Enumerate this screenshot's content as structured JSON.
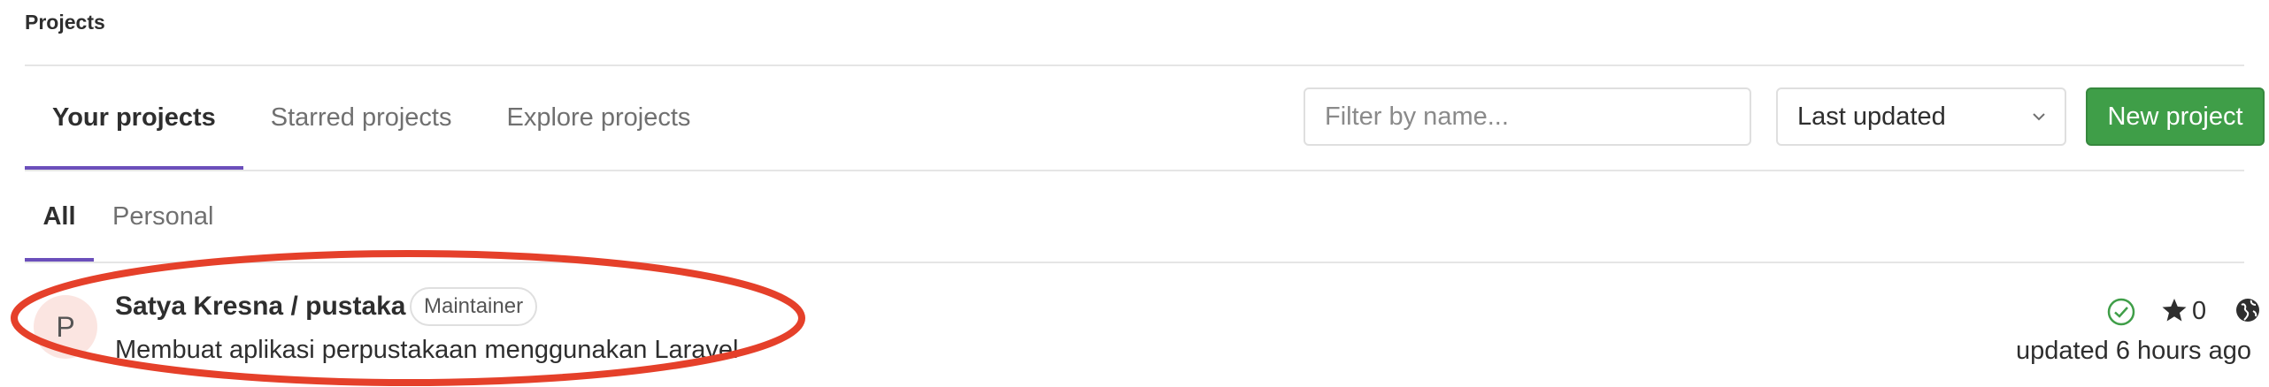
{
  "breadcrumb": "Projects",
  "tabs": [
    {
      "label": "Your projects",
      "active": true
    },
    {
      "label": "Starred projects",
      "active": false
    },
    {
      "label": "Explore projects",
      "active": false
    }
  ],
  "filter": {
    "placeholder": "Filter by name..."
  },
  "sort": {
    "label": "Last updated"
  },
  "new_project": {
    "label": "New project"
  },
  "subtabs": [
    {
      "label": "All",
      "active": true
    },
    {
      "label": "Personal",
      "active": false
    }
  ],
  "project": {
    "avatar_letter": "P",
    "name": "Satya Kresna / pustaka",
    "role": "Maintainer",
    "description": "Membuat aplikasi perpustakaan menggunakan Laravel",
    "star_count": "0",
    "updated": "updated 6 hours ago",
    "status_icon": "check-circle-icon",
    "visibility_icon": "globe-icon"
  },
  "colors": {
    "accent": "#6b4fbb",
    "primary_button": "#3f9e48",
    "status_success": "#3f9e48",
    "annotation": "#e5402a"
  }
}
